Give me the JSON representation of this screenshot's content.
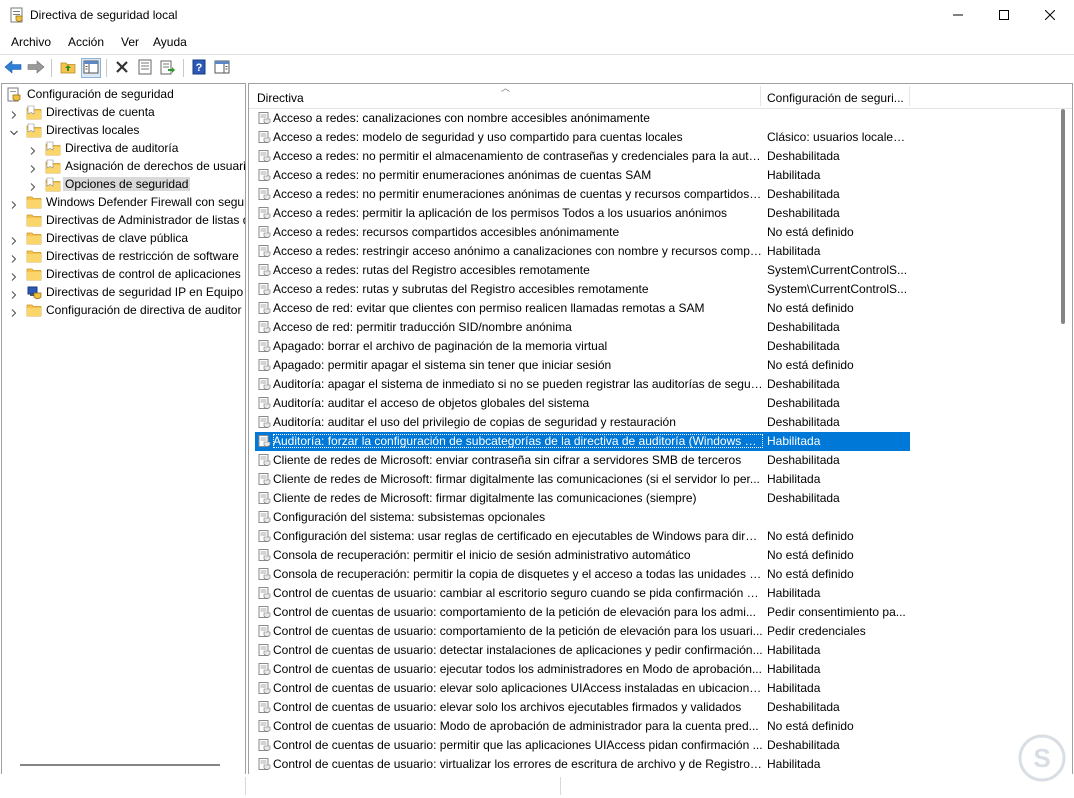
{
  "window": {
    "title": "Directiva de seguridad local",
    "icon": "security-policy-icon",
    "controls": [
      "minimize-icon",
      "maximize-icon",
      "close-icon"
    ]
  },
  "menu": {
    "file": "Archivo",
    "action": "Acción",
    "view": "Ver",
    "help": "Ayuda"
  },
  "toolbar": [
    "back-arrow-icon",
    "forward-arrow-icon",
    "up-folder-icon",
    "show-hide-tree-icon",
    "delete-icon",
    "properties-icon",
    "export-list-icon",
    "help-icon",
    "show-hide-action-pane-icon"
  ],
  "tree": {
    "root": "Configuración de seguridad",
    "items": [
      {
        "label": "Directivas de cuenta",
        "level": 1,
        "expand": "collapsed"
      },
      {
        "label": "Directivas locales",
        "level": 1,
        "expand": "expanded"
      },
      {
        "label": "Directiva de auditoría",
        "level": 2,
        "expand": "collapsed"
      },
      {
        "label": "Asignación de derechos de usuari",
        "level": 2,
        "expand": "collapsed"
      },
      {
        "label": "Opciones de seguridad",
        "level": 2,
        "expand": "collapsed",
        "selected": true
      },
      {
        "label": "Windows Defender Firewall con segur",
        "level": 1,
        "expand": "collapsed"
      },
      {
        "label": "Directivas de Administrador de listas d",
        "level": 1,
        "expand": "none"
      },
      {
        "label": "Directivas de clave pública",
        "level": 1,
        "expand": "collapsed"
      },
      {
        "label": "Directivas de restricción de software",
        "level": 1,
        "expand": "collapsed"
      },
      {
        "label": "Directivas de control de aplicaciones",
        "level": 1,
        "expand": "collapsed"
      },
      {
        "label": "Directivas de seguridad IP en Equipo l",
        "level": 1,
        "expand": "collapsed",
        "icon": "ip-security-icon"
      },
      {
        "label": "Configuración de directiva de auditor",
        "level": 1,
        "expand": "collapsed"
      }
    ]
  },
  "list": {
    "columns": {
      "policy": "Directiva",
      "setting": "Configuración de seguri..."
    },
    "selected_index": 17,
    "rows": [
      {
        "policy": "Acceso a redes: canalizaciones con nombre accesibles anónimamente",
        "setting": ""
      },
      {
        "policy": "Acceso a redes: modelo de seguridad y uso compartido para cuentas locales",
        "setting": "Clásico: usuarios locales..."
      },
      {
        "policy": "Acceso a redes: no permitir el almacenamiento de contraseñas y credenciales para la auten...",
        "setting": "Deshabilitada"
      },
      {
        "policy": "Acceso a redes: no permitir enumeraciones anónimas de cuentas SAM",
        "setting": "Habilitada"
      },
      {
        "policy": "Acceso a redes: no permitir enumeraciones anónimas de cuentas y recursos compartidos S...",
        "setting": "Deshabilitada"
      },
      {
        "policy": "Acceso a redes: permitir la aplicación de los permisos Todos a los usuarios anónimos",
        "setting": "Deshabilitada"
      },
      {
        "policy": "Acceso a redes: recursos compartidos accesibles anónimamente",
        "setting": "No está definido"
      },
      {
        "policy": "Acceso a redes: restringir acceso anónimo a canalizaciones con nombre y recursos compar...",
        "setting": "Habilitada"
      },
      {
        "policy": "Acceso a redes: rutas del Registro accesibles remotamente",
        "setting": "System\\CurrentControlS..."
      },
      {
        "policy": "Acceso a redes: rutas y subrutas del Registro accesibles remotamente",
        "setting": "System\\CurrentControlS..."
      },
      {
        "policy": "Acceso de red: evitar que clientes con permiso realicen llamadas remotas a SAM",
        "setting": "No está definido"
      },
      {
        "policy": "Acceso de red: permitir traducción SID/nombre anónima",
        "setting": "Deshabilitada"
      },
      {
        "policy": "Apagado: borrar el archivo de paginación de la memoria virtual",
        "setting": "Deshabilitada"
      },
      {
        "policy": "Apagado: permitir apagar el sistema sin tener que iniciar sesión",
        "setting": "No está definido"
      },
      {
        "policy": "Auditoría: apagar el sistema de inmediato si no se pueden registrar las auditorías de seguri...",
        "setting": "Deshabilitada"
      },
      {
        "policy": "Auditoría: auditar el acceso de objetos globales del sistema",
        "setting": "Deshabilitada"
      },
      {
        "policy": "Auditoría: auditar el uso del privilegio de copias de seguridad y restauración",
        "setting": "Deshabilitada"
      },
      {
        "policy": "Auditoría: forzar la configuración de subcategorías de la directiva de auditoría (Windows Vi...",
        "setting": "Habilitada"
      },
      {
        "policy": "Cliente de redes de Microsoft: enviar contraseña sin cifrar a servidores SMB de terceros",
        "setting": "Deshabilitada"
      },
      {
        "policy": "Cliente de redes de Microsoft: firmar digitalmente las comunicaciones (si el servidor lo per...",
        "setting": "Habilitada"
      },
      {
        "policy": "Cliente de redes de Microsoft: firmar digitalmente las comunicaciones (siempre)",
        "setting": "Deshabilitada"
      },
      {
        "policy": "Configuración del sistema: subsistemas opcionales",
        "setting": ""
      },
      {
        "policy": "Configuración del sistema: usar reglas de certificado en ejecutables de Windows para direc...",
        "setting": "No está definido"
      },
      {
        "policy": "Consola de recuperación: permitir el inicio de sesión administrativo automático",
        "setting": "No está definido"
      },
      {
        "policy": "Consola de recuperación: permitir la copia de disquetes y el acceso a todas las unidades y ...",
        "setting": "No está definido"
      },
      {
        "policy": "Control de cuentas de usuario: cambiar al escritorio seguro cuando se pida confirmación d...",
        "setting": "Habilitada"
      },
      {
        "policy": "Control de cuentas de usuario: comportamiento de la petición de elevación para los admi...",
        "setting": "Pedir consentimiento pa..."
      },
      {
        "policy": "Control de cuentas de usuario: comportamiento de la petición de elevación para los usuari...",
        "setting": "Pedir credenciales"
      },
      {
        "policy": "Control de cuentas de usuario: detectar instalaciones de aplicaciones y pedir confirmación...",
        "setting": "Habilitada"
      },
      {
        "policy": "Control de cuentas de usuario: ejecutar todos los administradores en Modo de aprobación...",
        "setting": "Habilitada"
      },
      {
        "policy": "Control de cuentas de usuario: elevar solo aplicaciones UIAccess instaladas en ubicaciones...",
        "setting": "Habilitada"
      },
      {
        "policy": "Control de cuentas de usuario: elevar solo los archivos ejecutables firmados y validados",
        "setting": "Deshabilitada"
      },
      {
        "policy": "Control de cuentas de usuario: Modo de aprobación de administrador para la cuenta pred...",
        "setting": "No está definido"
      },
      {
        "policy": "Control de cuentas de usuario: permitir que las aplicaciones UIAccess pidan confirmación ...",
        "setting": "Deshabilitada"
      },
      {
        "policy": "Control de cuentas de usuario: virtualizar los errores de escritura de archivo y de Registro e...",
        "setting": "Habilitada"
      }
    ]
  },
  "watermark": "solvetic-logo",
  "colors": {
    "selection": "#0078d7",
    "folder": "#f5c24c",
    "tree_selected": "#d9d9d9"
  }
}
